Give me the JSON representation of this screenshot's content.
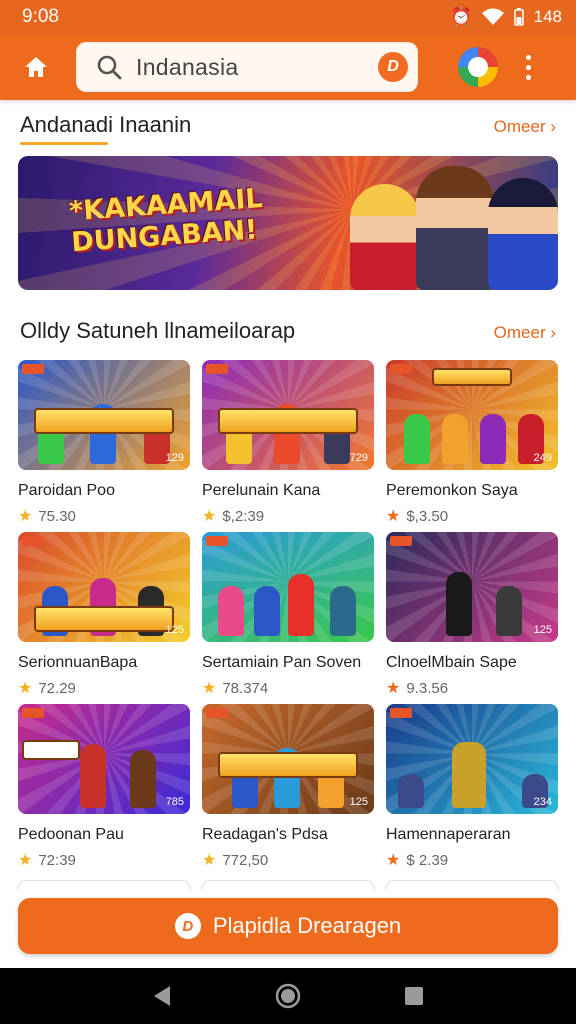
{
  "status": {
    "time": "9:08",
    "battery": "148"
  },
  "search": {
    "value": "Indanasia"
  },
  "sections": {
    "featured": {
      "title": "Andanadi Inaanin",
      "more": "Omeer ›"
    },
    "popular": {
      "title": "Olldy Satuneh llnameiloarap",
      "more": "Omeer ›"
    }
  },
  "banner": {
    "text": "*KAKAAMAIL DUNGABAN!"
  },
  "games": [
    {
      "title": "Paroidan Poo",
      "rating": "75.30",
      "thumb_text": "PERNEAN RONULAS",
      "badge": "129",
      "colors": [
        "#2b57c8",
        "#f3a12b"
      ]
    },
    {
      "title": "Perelunain Kana",
      "rating": "$,2:39",
      "thumb_text": "PRANDAN RONULAS",
      "badge": "729",
      "colors": [
        "#8c2bb8",
        "#f37a2b"
      ]
    },
    {
      "title": "Peremonkon Saya",
      "rating": "$,3.50",
      "thumb_text": "MINEDEIL",
      "badge": "249",
      "colors": [
        "#c83a2b",
        "#f3c12b"
      ]
    },
    {
      "title": "SerionnuanBapa",
      "rating": "72.29",
      "thumb_text": "SPENNEAKI",
      "badge": "125",
      "colors": [
        "#d84a2b",
        "#f3d02b"
      ]
    },
    {
      "title": "Sertamiain Pan Soven",
      "rating": "78.374",
      "thumb_text": "",
      "badge": "",
      "colors": [
        "#2b9ad8",
        "#3ac84a"
      ]
    },
    {
      "title": "ClnoelMbain Sape",
      "rating": "9.3.56",
      "thumb_text": "",
      "badge": "125",
      "colors": [
        "#2a2a5a",
        "#c83a8a"
      ]
    },
    {
      "title": "Pedoonan Pau",
      "rating": "72:39",
      "thumb_text": "LABI OAOKH",
      "badge": "785",
      "colors": [
        "#c82b8a",
        "#3a2ad8"
      ]
    },
    {
      "title": "Readagan's Pdsa",
      "rating": "772,50",
      "thumb_text": "JKRNEIAN RONULAS",
      "badge": "125",
      "colors": [
        "#c86a2b",
        "#6a3a1a"
      ]
    },
    {
      "title": "Hamennaperaran",
      "rating": "$ 2.39",
      "thumb_text": "",
      "badge": "234",
      "colors": [
        "#1a3a8a",
        "#2ab8d8"
      ]
    }
  ],
  "cta": {
    "label": "Plapidla Drearagen"
  }
}
